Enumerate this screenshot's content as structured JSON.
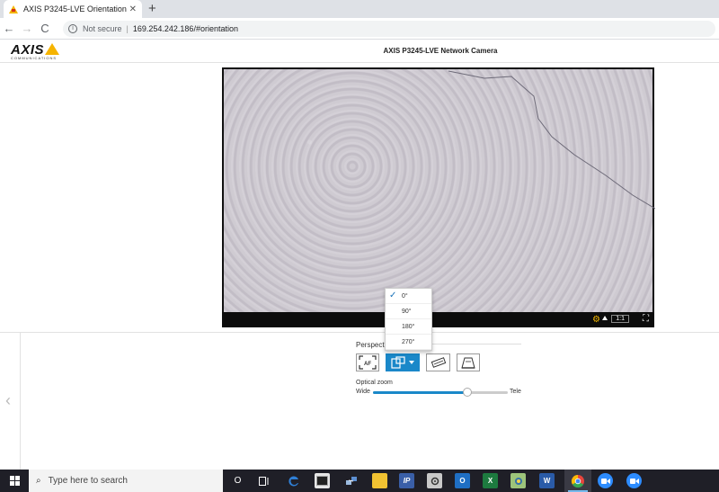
{
  "browser": {
    "tab_title": "AXIS P3245-LVE Orientation",
    "tab_close": "✕",
    "new_tab": "+",
    "back": "←",
    "forward": "→",
    "reload": "C",
    "info": "i",
    "security": "Not secure",
    "separator": "|",
    "url": "169.254.242.186/#orientation"
  },
  "header": {
    "logo": "AXIS",
    "logo_sub": "COMMUNICATIONS",
    "product_title": "AXIS P3245-LVE Network Camera"
  },
  "video": {
    "zoom_ratio": "1:1",
    "gear_glyph": "⚙",
    "fullscreen_glyph": "⛶"
  },
  "orientation_menu": {
    "options": [
      "0°",
      "90°",
      "180°",
      "270°"
    ],
    "selected_index": 0,
    "check": "✓"
  },
  "controls": {
    "section_title": "Perspective",
    "af_label": "AF",
    "back_chevron": "‹",
    "optical_zoom_label": "Optical zoom",
    "wide_label": "Wide",
    "tele_label": "Tele",
    "zoom_level": 0.7
  },
  "taskbar": {
    "search_placeholder": "Type here to search",
    "search_glyph": "⌕",
    "task_view_glyph": "O",
    "ip_label": "IP",
    "outlook_label": "O",
    "excel_label": "X",
    "word_label": "W",
    "colors": {
      "edge": "#2f7fd6",
      "explorer": "#f1c232",
      "ip": "#3a5fa8",
      "outlook": "#1f6fc4",
      "excel": "#1d7a3f",
      "word": "#2a5ba8",
      "chrome": "#e8453c",
      "zoom": "#2d8cff"
    }
  }
}
